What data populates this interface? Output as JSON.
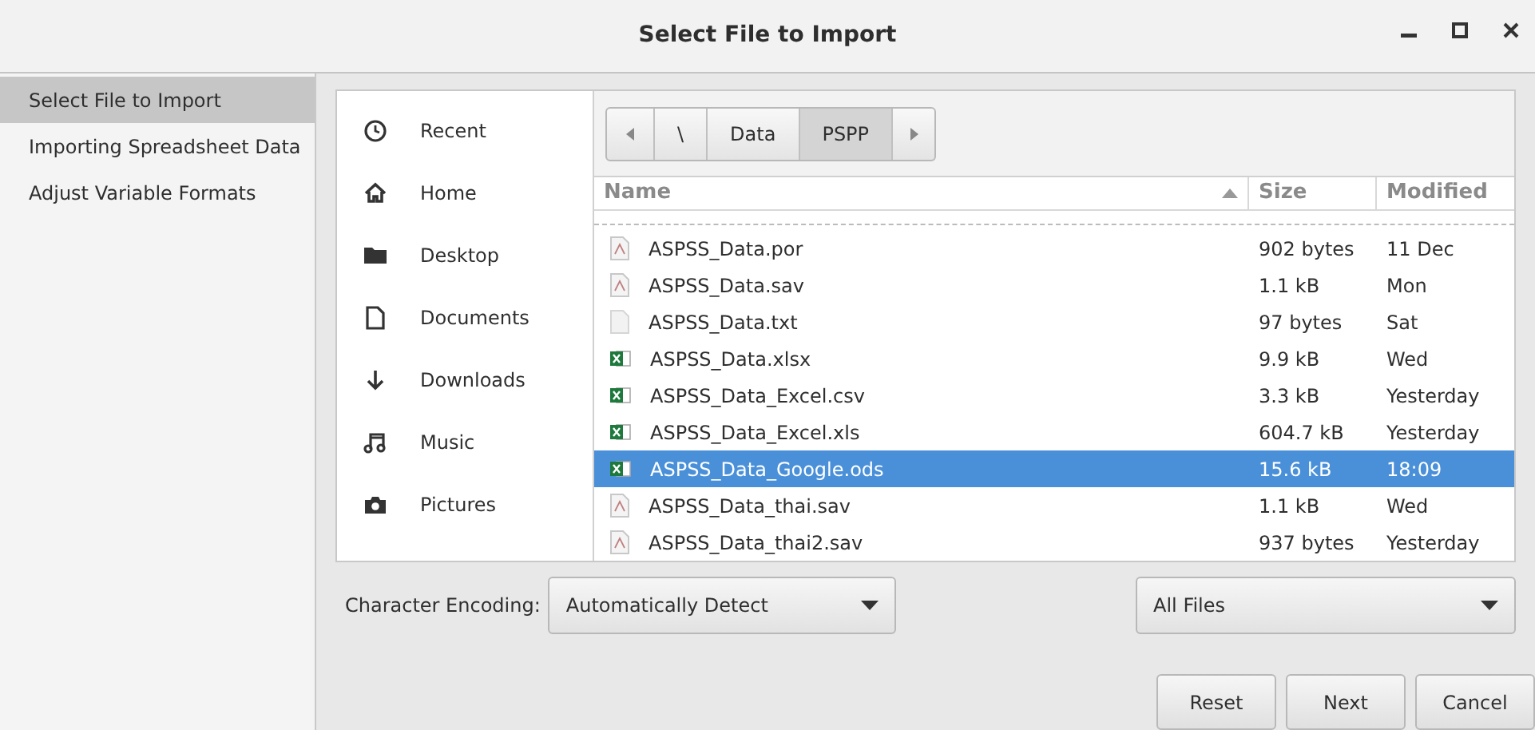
{
  "window": {
    "title": "Select File to Import"
  },
  "steps": [
    {
      "label": "Select File to Import",
      "selected": true
    },
    {
      "label": "Importing Spreadsheet Data",
      "selected": false
    },
    {
      "label": "Adjust Variable Formats",
      "selected": false
    }
  ],
  "places": [
    {
      "label": "Recent",
      "kind": "recent"
    },
    {
      "label": "Home",
      "kind": "home"
    },
    {
      "label": "Desktop",
      "kind": "folder"
    },
    {
      "label": "Documents",
      "kind": "document"
    },
    {
      "label": "Downloads",
      "kind": "download"
    },
    {
      "label": "Music",
      "kind": "music"
    },
    {
      "label": "Pictures",
      "kind": "camera"
    }
  ],
  "path": [
    {
      "label": "\\",
      "selected": false
    },
    {
      "label": "Data",
      "selected": false
    },
    {
      "label": "PSPP",
      "selected": true
    }
  ],
  "columns": [
    "Name",
    "Size",
    "Modified"
  ],
  "files": [
    {
      "name": "ASPSS_Data.por",
      "size": "902 bytes",
      "modified": "11 Dec",
      "kind": "spss",
      "selected": false
    },
    {
      "name": "ASPSS_Data.sav",
      "size": "1.1 kB",
      "modified": "Mon",
      "kind": "spss",
      "selected": false
    },
    {
      "name": "ASPSS_Data.txt",
      "size": "97 bytes",
      "modified": "Sat",
      "kind": "text",
      "selected": false
    },
    {
      "name": "ASPSS_Data.xlsx",
      "size": "9.9 kB",
      "modified": "Wed",
      "kind": "sheet",
      "selected": false
    },
    {
      "name": "ASPSS_Data_Excel.csv",
      "size": "3.3 kB",
      "modified": "Yesterday",
      "kind": "sheet",
      "selected": false
    },
    {
      "name": "ASPSS_Data_Excel.xls",
      "size": "604.7 kB",
      "modified": "Yesterday",
      "kind": "sheet",
      "selected": false
    },
    {
      "name": "ASPSS_Data_Google.ods",
      "size": "15.6 kB",
      "modified": "18:09",
      "kind": "sheet",
      "selected": true
    },
    {
      "name": "ASPSS_Data_thai.sav",
      "size": "1.1 kB",
      "modified": "Wed",
      "kind": "spss",
      "selected": false
    },
    {
      "name": "ASPSS_Data_thai2.sav",
      "size": "937 bytes",
      "modified": "Yesterday",
      "kind": "spss",
      "selected": false
    }
  ],
  "encoding": {
    "label": "Character Encoding:",
    "value": "Automatically Detect"
  },
  "filter": {
    "value": "All Files"
  },
  "buttons": [
    "Reset",
    "Next",
    "Cancel"
  ]
}
